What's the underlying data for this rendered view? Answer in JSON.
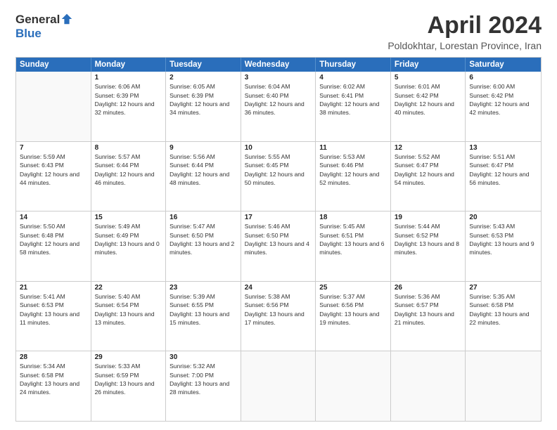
{
  "logo": {
    "general": "General",
    "blue": "Blue"
  },
  "title": "April 2024",
  "subtitle": "Poldokhtar, Lorestan Province, Iran",
  "days": [
    "Sunday",
    "Monday",
    "Tuesday",
    "Wednesday",
    "Thursday",
    "Friday",
    "Saturday"
  ],
  "weeks": [
    [
      {
        "day": "",
        "sunrise": "",
        "sunset": "",
        "daylight": ""
      },
      {
        "day": "1",
        "sunrise": "Sunrise: 6:06 AM",
        "sunset": "Sunset: 6:39 PM",
        "daylight": "Daylight: 12 hours and 32 minutes."
      },
      {
        "day": "2",
        "sunrise": "Sunrise: 6:05 AM",
        "sunset": "Sunset: 6:39 PM",
        "daylight": "Daylight: 12 hours and 34 minutes."
      },
      {
        "day": "3",
        "sunrise": "Sunrise: 6:04 AM",
        "sunset": "Sunset: 6:40 PM",
        "daylight": "Daylight: 12 hours and 36 minutes."
      },
      {
        "day": "4",
        "sunrise": "Sunrise: 6:02 AM",
        "sunset": "Sunset: 6:41 PM",
        "daylight": "Daylight: 12 hours and 38 minutes."
      },
      {
        "day": "5",
        "sunrise": "Sunrise: 6:01 AM",
        "sunset": "Sunset: 6:42 PM",
        "daylight": "Daylight: 12 hours and 40 minutes."
      },
      {
        "day": "6",
        "sunrise": "Sunrise: 6:00 AM",
        "sunset": "Sunset: 6:42 PM",
        "daylight": "Daylight: 12 hours and 42 minutes."
      }
    ],
    [
      {
        "day": "7",
        "sunrise": "Sunrise: 5:59 AM",
        "sunset": "Sunset: 6:43 PM",
        "daylight": "Daylight: 12 hours and 44 minutes."
      },
      {
        "day": "8",
        "sunrise": "Sunrise: 5:57 AM",
        "sunset": "Sunset: 6:44 PM",
        "daylight": "Daylight: 12 hours and 46 minutes."
      },
      {
        "day": "9",
        "sunrise": "Sunrise: 5:56 AM",
        "sunset": "Sunset: 6:44 PM",
        "daylight": "Daylight: 12 hours and 48 minutes."
      },
      {
        "day": "10",
        "sunrise": "Sunrise: 5:55 AM",
        "sunset": "Sunset: 6:45 PM",
        "daylight": "Daylight: 12 hours and 50 minutes."
      },
      {
        "day": "11",
        "sunrise": "Sunrise: 5:53 AM",
        "sunset": "Sunset: 6:46 PM",
        "daylight": "Daylight: 12 hours and 52 minutes."
      },
      {
        "day": "12",
        "sunrise": "Sunrise: 5:52 AM",
        "sunset": "Sunset: 6:47 PM",
        "daylight": "Daylight: 12 hours and 54 minutes."
      },
      {
        "day": "13",
        "sunrise": "Sunrise: 5:51 AM",
        "sunset": "Sunset: 6:47 PM",
        "daylight": "Daylight: 12 hours and 56 minutes."
      }
    ],
    [
      {
        "day": "14",
        "sunrise": "Sunrise: 5:50 AM",
        "sunset": "Sunset: 6:48 PM",
        "daylight": "Daylight: 12 hours and 58 minutes."
      },
      {
        "day": "15",
        "sunrise": "Sunrise: 5:49 AM",
        "sunset": "Sunset: 6:49 PM",
        "daylight": "Daylight: 13 hours and 0 minutes."
      },
      {
        "day": "16",
        "sunrise": "Sunrise: 5:47 AM",
        "sunset": "Sunset: 6:50 PM",
        "daylight": "Daylight: 13 hours and 2 minutes."
      },
      {
        "day": "17",
        "sunrise": "Sunrise: 5:46 AM",
        "sunset": "Sunset: 6:50 PM",
        "daylight": "Daylight: 13 hours and 4 minutes."
      },
      {
        "day": "18",
        "sunrise": "Sunrise: 5:45 AM",
        "sunset": "Sunset: 6:51 PM",
        "daylight": "Daylight: 13 hours and 6 minutes."
      },
      {
        "day": "19",
        "sunrise": "Sunrise: 5:44 AM",
        "sunset": "Sunset: 6:52 PM",
        "daylight": "Daylight: 13 hours and 8 minutes."
      },
      {
        "day": "20",
        "sunrise": "Sunrise: 5:43 AM",
        "sunset": "Sunset: 6:53 PM",
        "daylight": "Daylight: 13 hours and 9 minutes."
      }
    ],
    [
      {
        "day": "21",
        "sunrise": "Sunrise: 5:41 AM",
        "sunset": "Sunset: 6:53 PM",
        "daylight": "Daylight: 13 hours and 11 minutes."
      },
      {
        "day": "22",
        "sunrise": "Sunrise: 5:40 AM",
        "sunset": "Sunset: 6:54 PM",
        "daylight": "Daylight: 13 hours and 13 minutes."
      },
      {
        "day": "23",
        "sunrise": "Sunrise: 5:39 AM",
        "sunset": "Sunset: 6:55 PM",
        "daylight": "Daylight: 13 hours and 15 minutes."
      },
      {
        "day": "24",
        "sunrise": "Sunrise: 5:38 AM",
        "sunset": "Sunset: 6:56 PM",
        "daylight": "Daylight: 13 hours and 17 minutes."
      },
      {
        "day": "25",
        "sunrise": "Sunrise: 5:37 AM",
        "sunset": "Sunset: 6:56 PM",
        "daylight": "Daylight: 13 hours and 19 minutes."
      },
      {
        "day": "26",
        "sunrise": "Sunrise: 5:36 AM",
        "sunset": "Sunset: 6:57 PM",
        "daylight": "Daylight: 13 hours and 21 minutes."
      },
      {
        "day": "27",
        "sunrise": "Sunrise: 5:35 AM",
        "sunset": "Sunset: 6:58 PM",
        "daylight": "Daylight: 13 hours and 22 minutes."
      }
    ],
    [
      {
        "day": "28",
        "sunrise": "Sunrise: 5:34 AM",
        "sunset": "Sunset: 6:58 PM",
        "daylight": "Daylight: 13 hours and 24 minutes."
      },
      {
        "day": "29",
        "sunrise": "Sunrise: 5:33 AM",
        "sunset": "Sunset: 6:59 PM",
        "daylight": "Daylight: 13 hours and 26 minutes."
      },
      {
        "day": "30",
        "sunrise": "Sunrise: 5:32 AM",
        "sunset": "Sunset: 7:00 PM",
        "daylight": "Daylight: 13 hours and 28 minutes."
      },
      {
        "day": "",
        "sunrise": "",
        "sunset": "",
        "daylight": ""
      },
      {
        "day": "",
        "sunrise": "",
        "sunset": "",
        "daylight": ""
      },
      {
        "day": "",
        "sunrise": "",
        "sunset": "",
        "daylight": ""
      },
      {
        "day": "",
        "sunrise": "",
        "sunset": "",
        "daylight": ""
      }
    ]
  ]
}
